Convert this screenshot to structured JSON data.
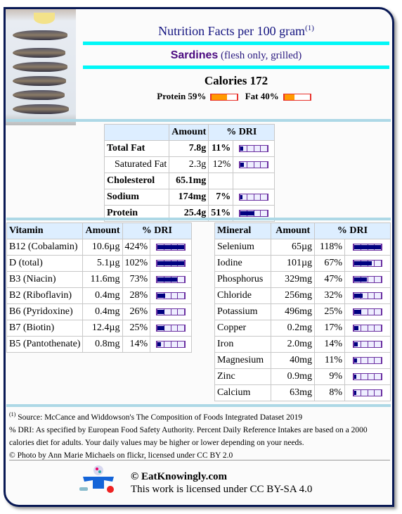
{
  "header": {
    "title": "Nutrition Facts per 100 gram",
    "title_note": "(1)",
    "food_name": "Sardines",
    "food_desc": "(flesh only, grilled)",
    "calories": "Calories 172",
    "protein_label": "Protein 59%",
    "protein_pct": 59,
    "fat_label": "Fat 40%",
    "fat_pct": 40
  },
  "colors": {
    "bar_fill": "#000080",
    "bar_border": "#6a2fa0",
    "macro_fill": "#ff9a00",
    "macro_border": "#e8322c",
    "accent": "#00f7f7"
  },
  "main": {
    "headers": [
      "",
      "Amount",
      "% DRI"
    ],
    "rows": [
      {
        "name": "Total Fat",
        "amount": "7.8g",
        "dri": "11%",
        "pct": 11,
        "bold": true
      },
      {
        "name": "Saturated Fat",
        "amount": "2.3g",
        "dri": "12%",
        "pct": 12,
        "bold": false
      },
      {
        "name": "Cholesterol",
        "amount": "65.1mg",
        "dri": "",
        "pct": null,
        "bold": true
      },
      {
        "name": "Sodium",
        "amount": "174mg",
        "dri": "7%",
        "pct": 7,
        "bold": true
      },
      {
        "name": "Protein",
        "amount": "25.4g",
        "dri": "51%",
        "pct": 51,
        "bold": true
      }
    ]
  },
  "vitamins": {
    "headers": [
      "Vitamin",
      "Amount",
      "% DRI"
    ],
    "rows": [
      {
        "name": "B12 (Cobalamin)",
        "amount": "10.6µg",
        "dri": "424%",
        "pct": 424
      },
      {
        "name": "D (total)",
        "amount": "5.1µg",
        "dri": "102%",
        "pct": 102
      },
      {
        "name": "B3 (Niacin)",
        "amount": "11.6mg",
        "dri": "73%",
        "pct": 73
      },
      {
        "name": "B2 (Riboflavin)",
        "amount": "0.4mg",
        "dri": "28%",
        "pct": 28
      },
      {
        "name": "B6 (Pyridoxine)",
        "amount": "0.4mg",
        "dri": "26%",
        "pct": 26
      },
      {
        "name": "B7 (Biotin)",
        "amount": "12.4µg",
        "dri": "25%",
        "pct": 25
      },
      {
        "name": "B5 (Pantothenate)",
        "amount": "0.8mg",
        "dri": "14%",
        "pct": 14
      }
    ]
  },
  "minerals": {
    "headers": [
      "Mineral",
      "Amount",
      "% DRI"
    ],
    "rows": [
      {
        "name": "Selenium",
        "amount": "65µg",
        "dri": "118%",
        "pct": 118
      },
      {
        "name": "Iodine",
        "amount": "101µg",
        "dri": "67%",
        "pct": 67
      },
      {
        "name": "Phosphorus",
        "amount": "329mg",
        "dri": "47%",
        "pct": 47
      },
      {
        "name": "Chloride",
        "amount": "256mg",
        "dri": "32%",
        "pct": 32
      },
      {
        "name": "Potassium",
        "amount": "496mg",
        "dri": "25%",
        "pct": 25
      },
      {
        "name": "Copper",
        "amount": "0.2mg",
        "dri": "17%",
        "pct": 17
      },
      {
        "name": "Iron",
        "amount": "2.0mg",
        "dri": "14%",
        "pct": 14
      },
      {
        "name": "Magnesium",
        "amount": "40mg",
        "dri": "11%",
        "pct": 11
      },
      {
        "name": "Zinc",
        "amount": "0.9mg",
        "dri": "9%",
        "pct": 9
      },
      {
        "name": "Calcium",
        "amount": "63mg",
        "dri": "8%",
        "pct": 8
      }
    ]
  },
  "footer": {
    "note_mark": "(1)",
    "source": " Source: McCance and Widdowson's The Composition of Foods Integrated Dataset 2019",
    "dri_note": "% DRI: As specified by European Food Safety Authority. Percent Daily Reference Intakes are based on a 2000 calories diet for adults. Your daily values may be higher or lower depending on your needs.",
    "photo_credit": "© Photo by Ann Marie Michaels on flickr, licensed under CC BY 2.0",
    "brand": "© EatKnowingly.com",
    "license": "This work is licensed under CC BY-SA 4.0"
  }
}
